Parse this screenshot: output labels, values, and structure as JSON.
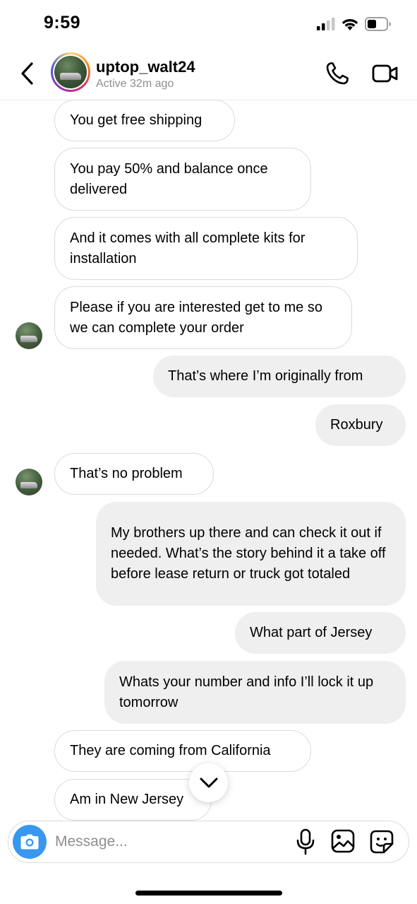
{
  "status_bar": {
    "time": "9:59"
  },
  "header": {
    "username": "uptop_walt24",
    "active_status": "Active 32m ago"
  },
  "messages": [
    {
      "side": "in",
      "text": "You get free shipping"
    },
    {
      "side": "in",
      "text": "You pay 50% and balance once delivered"
    },
    {
      "side": "in",
      "text": "And it comes with all complete kits for installation"
    },
    {
      "side": "in",
      "text": "Please if you are interested get to me so we can complete your order"
    },
    {
      "side": "out",
      "text": "That’s where I’m originally from"
    },
    {
      "side": "out",
      "text": "Roxbury"
    },
    {
      "side": "in",
      "text": "That’s no problem"
    },
    {
      "side": "out",
      "text": "My brothers up there and can check it out if needed.  What’s the story behind it a take off before lease return or truck got totaled"
    },
    {
      "side": "out",
      "text": "What part of Jersey"
    },
    {
      "side": "out",
      "text": "Whats your number and info I’ll lock it up tomorrow"
    },
    {
      "side": "in",
      "text": "They are coming from California"
    },
    {
      "side": "in",
      "text": "Am in New Jersey"
    }
  ],
  "composer": {
    "placeholder": "Message..."
  },
  "colors": {
    "accent_blue": "#3897f0",
    "outgoing_bubble": "#efefef",
    "incoming_border": "#dbdbdb"
  },
  "icons": [
    "back-chevron-icon",
    "phone-icon",
    "video-camera-icon",
    "camera-icon",
    "microphone-icon",
    "gallery-icon",
    "sticker-icon",
    "chevron-down-icon"
  ]
}
